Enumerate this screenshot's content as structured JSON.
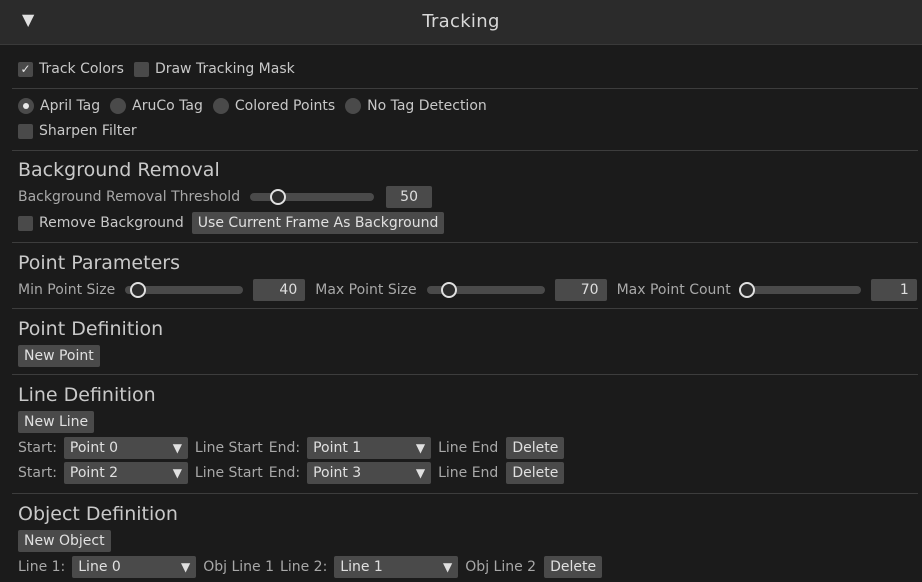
{
  "panel": {
    "title": "Tracking",
    "collapse_icon": "triangle-down-icon"
  },
  "toggles": {
    "track_colors": {
      "label": "Track Colors",
      "checked": true
    },
    "draw_tracking_mask": {
      "label": "Draw Tracking Mask",
      "checked": false
    }
  },
  "detection": {
    "options": [
      "April Tag",
      "AruCo Tag",
      "Colored Points",
      "No Tag Detection"
    ],
    "selected": "April Tag",
    "sharpen_filter": {
      "label": "Sharpen Filter",
      "checked": false
    }
  },
  "background_removal": {
    "heading": "Background Removal",
    "threshold_label": "Background Removal Threshold",
    "threshold_value": "50",
    "remove_background_label": "Remove Background",
    "remove_background_checked": false,
    "use_frame_button": "Use Current Frame As Background"
  },
  "point_parameters": {
    "heading": "Point Parameters",
    "min_size_label": "Min Point Size",
    "min_size_value": "40",
    "max_size_label": "Max Point Size",
    "max_size_value": "70",
    "max_count_label": "Max Point Count",
    "max_count_value": "1"
  },
  "point_definition": {
    "heading": "Point Definition",
    "new_button": "New Point"
  },
  "line_definition": {
    "heading": "Line Definition",
    "new_button": "New Line",
    "start_label": "Start:",
    "end_label": "End:",
    "start_suffix": "Line Start",
    "end_suffix": "Line End",
    "delete_label": "Delete",
    "lines": [
      {
        "start": "Point 0",
        "end": "Point 1"
      },
      {
        "start": "Point 2",
        "end": "Point 3"
      }
    ]
  },
  "object_definition": {
    "heading": "Object Definition",
    "new_button": "New Object",
    "line1_label": "Line 1:",
    "line1_value": "Line 0",
    "line1_suffix": "Obj Line 1",
    "line2_label": "Line 2:",
    "line2_value": "Line 1",
    "line2_suffix": "Obj Line 2",
    "delete_label": "Delete"
  }
}
